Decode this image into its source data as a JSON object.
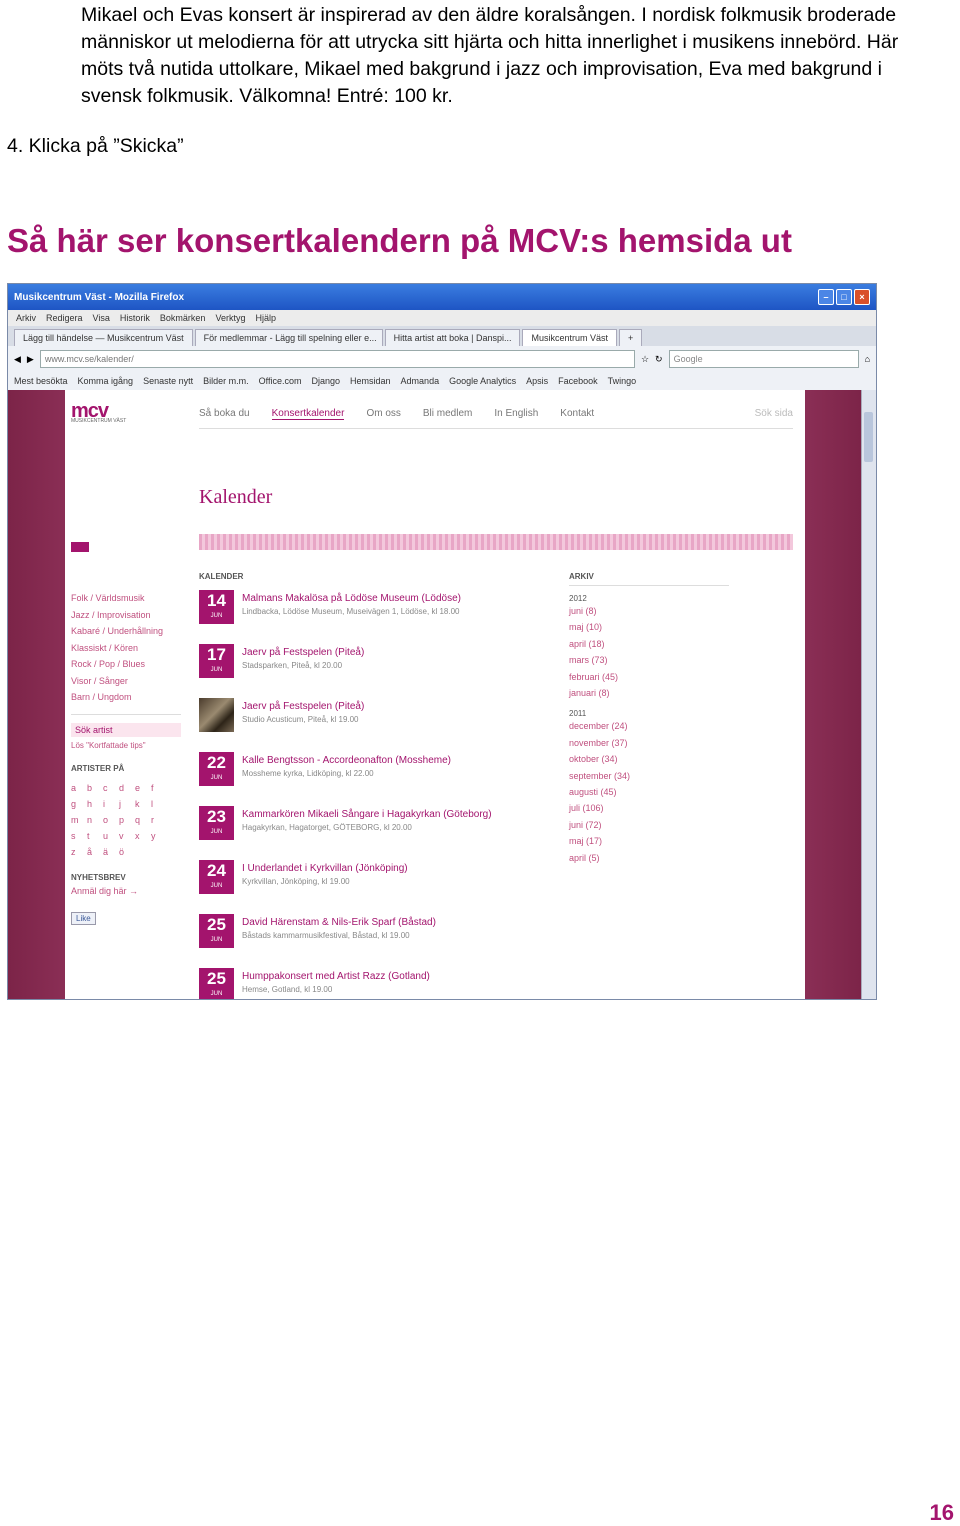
{
  "intro_paragraph": "Mikael och Evas konsert är inspirerad av den äldre koralsången. I nordisk folkmusik broderade människor ut melodierna för att utrycka sitt hjärta och hitta innerlighet i musikens innebörd. Här möts två nutida uttolkare, Mikael med bakgrund i jazz och improvisation, Eva med bakgrund i svensk folkmusik. Välkomna! Entré: 100 kr.",
  "step_text": "4. Klicka på ”Skicka”",
  "heading": "Så här ser konsertkalendern på MCV:s hemsida ut",
  "page_number": "16",
  "colors": {
    "accent": "#a3146d",
    "site_background": "#8b2f56",
    "titlebar": "#1e55c4"
  },
  "browser": {
    "window_title": "Musikcentrum Väst - Mozilla Firefox",
    "window_buttons": [
      "minimize-icon",
      "maximize-icon",
      "close-icon"
    ],
    "menu": [
      "Arkiv",
      "Redigera",
      "Visa",
      "Historik",
      "Bokmärken",
      "Verktyg",
      "Hjälp"
    ],
    "tabs": [
      {
        "label": "Lägg till händelse — Musikcentrum Väst"
      },
      {
        "label": "För medlemmar - Lägg till spelning eller e..."
      },
      {
        "label": "Hitta artist att boka | Danspi..."
      },
      {
        "label": "Musikcentrum Väst"
      }
    ],
    "url": "www.mcv.se/kalender/",
    "search_placeholder": "Google",
    "bookmarks": [
      "Mest besökta",
      "Komma igång",
      "Senaste nytt",
      "Bilder m.m.",
      "Office.com",
      "Django",
      "Hemsidan",
      "Admanda",
      "Google Analytics",
      "Apsis",
      "Facebook",
      "Twingo"
    ]
  },
  "site": {
    "logo": "mcv",
    "logo_sub": "MUSIKCENTRUM VÄST",
    "nav": [
      "Så boka du",
      "Konsertkalender",
      "Om oss",
      "Bli medlem",
      "In English",
      "Kontakt"
    ],
    "search_label": "Sök sida",
    "page_title": "Kalender",
    "categories": [
      "Folk / Världsmusik",
      "Jazz / Improvisation",
      "Kabaré / Underhållning",
      "Klassiskt / Kören",
      "Rock / Pop / Blues",
      "Visor / Sånger",
      "Barn / Ungdom"
    ],
    "ads_button": "Sök artist",
    "ads_sub": "Lös \"Kortfattade tips\"",
    "artists_heading": "ARTISTER PÅ",
    "letters": [
      "a",
      "b",
      "c",
      "d",
      "e",
      "f",
      "g",
      "h",
      "i",
      "j",
      "k",
      "l",
      "m",
      "n",
      "o",
      "p",
      "q",
      "r",
      "s",
      "t",
      "u",
      "v",
      "x",
      "y",
      "z",
      "å",
      "ä",
      "ö"
    ],
    "newsletter_heading": "NYHETSBREV",
    "newsletter_link": "Anmäl dig här →",
    "like_button": "Like",
    "calendar_heading": "KALENDER",
    "events": [
      {
        "day": "14",
        "month": "JUN",
        "title": "Malmans Makalösa på Lödöse Museum (Lödöse)",
        "info": "Lindbacka, Lödöse Museum, Museivägen 1, Lödöse, kl 18.00",
        "photo": false
      },
      {
        "day": "17",
        "month": "JUN",
        "title": "Jaerv på Festspelen (Piteå)",
        "info": "Stadsparken, Piteå, kl 20.00",
        "photo": false
      },
      {
        "day": "",
        "month": "",
        "title": "Jaerv på Festspelen (Piteå)",
        "info": "Studio Acusticum, Piteå, kl 19.00",
        "photo": true
      },
      {
        "day": "22",
        "month": "JUN",
        "title": "Kalle Bengtsson - Accordeonafton (Mossheme)",
        "info": "Mossheme kyrka, Lidköping, kl 22.00",
        "photo": false
      },
      {
        "day": "23",
        "month": "JUN",
        "title": "Kammarkören Mikaeli Sångare i Hagakyrkan (Göteborg)",
        "info": "Hagakyrkan, Hagatorget, GÖTEBORG, kl 20.00",
        "photo": false
      },
      {
        "day": "24",
        "month": "JUN",
        "title": "I Underlandet i Kyrkvillan (Jönköping)",
        "info": "Kyrkvillan, Jönköping, kl 19.00",
        "photo": false
      },
      {
        "day": "25",
        "month": "JUN",
        "title": "David Härenstam & Nils-Erik Sparf (Båstad)",
        "info": "Båstads kammarmusikfestival, Båstad, kl 19.00",
        "photo": false
      },
      {
        "day": "25",
        "month": "JUN",
        "title": "Humppakonsert med Artist Razz (Gotland)",
        "info": "Hemse, Gotland, kl 19.00",
        "photo": false
      }
    ],
    "archive_heading": "ARKIV",
    "archive": [
      {
        "year": "2012",
        "months": [
          "juni (8)",
          "maj (10)",
          "april (18)",
          "mars (73)",
          "februari (45)",
          "januari (8)"
        ]
      },
      {
        "year": "2011",
        "months": [
          "december (24)",
          "november (37)",
          "oktober (34)",
          "september (34)",
          "augusti (45)",
          "juli (106)",
          "juni (72)",
          "maj (17)",
          "april (5)"
        ]
      }
    ]
  }
}
